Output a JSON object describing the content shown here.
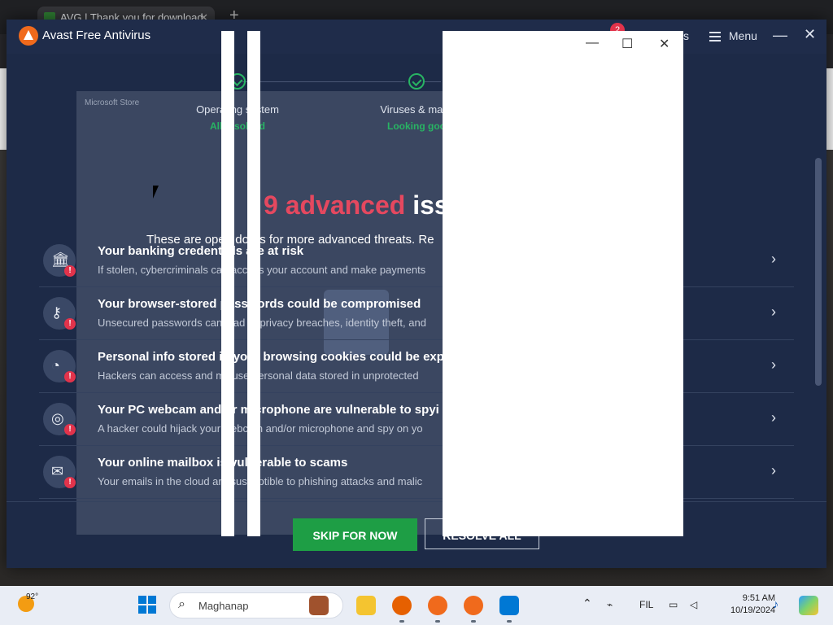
{
  "browser": {
    "tab_title": "AVG | Thank you for download",
    "tab_close": "✕",
    "new_tab": "+"
  },
  "avast": {
    "app_name": "Avast Free Antivirus",
    "notification_count": "2",
    "partial_label": "s",
    "menu_label": "Menu",
    "minimize": "—",
    "close": "✕",
    "store_label": "Microsoft Store",
    "steps": [
      {
        "label": "Operating system",
        "status": "All resolved"
      },
      {
        "label": "Viruses & malw",
        "status": "Looking goo"
      }
    ],
    "headline": {
      "count_text": "9 advanced",
      "rest": "iss"
    },
    "subline_left": "These are open doors for more advanced threats. Re",
    "subline_right": ".",
    "issues": [
      {
        "title": "Your banking credentials are at risk",
        "desc": "If stolen, cybercriminals can access your account and make payments",
        "icon": "bank-icon",
        "glyph": "🏛"
      },
      {
        "title": "Your browser-stored passwords could be compromised",
        "desc": "Unsecured passwords can lead to privacy breaches, identity theft, and",
        "icon": "key-icon",
        "glyph": "⚷"
      },
      {
        "title": "Personal info stored in your browsing cookies could be exp",
        "desc": "Hackers can access and misuse personal data stored in unprotected",
        "icon": "cookie-icon",
        "glyph": "◔"
      },
      {
        "title": "Your PC webcam and/or microphone are vulnerable to spyi",
        "desc": "A hacker could hijack your webcam and/or microphone and spy on yo",
        "icon": "webcam-icon",
        "glyph": "◎"
      },
      {
        "title": "Your online mailbox is vulnerable to scams",
        "desc": "Your emails in the cloud are susceptible to phishing attacks and malic",
        "icon": "mail-icon",
        "glyph": "✉"
      }
    ],
    "skip_button": "SKIP FOR NOW",
    "resolve_button": "RESOLVE ALL"
  },
  "overlay": {
    "minimize": "—",
    "maximize": "☐",
    "close": "✕"
  },
  "taskbar": {
    "temperature": "92°",
    "search_placeholder": "Maghanap",
    "language": "FIL",
    "time": "9:51 AM",
    "date": "10/19/2024"
  }
}
